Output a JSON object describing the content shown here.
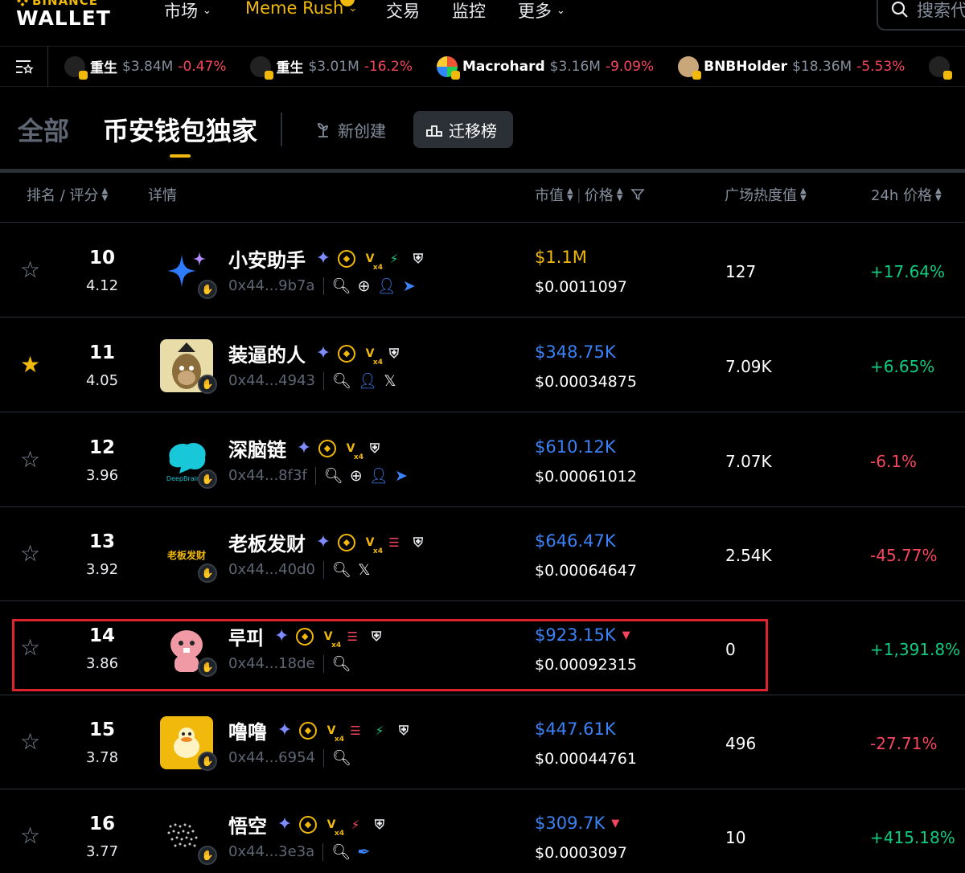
{
  "brand": {
    "top": "BINANCE",
    "name": "WALLET"
  },
  "nav": [
    {
      "label": "市场",
      "dropdown": true
    },
    {
      "label": "Meme Rush",
      "dropdown": true,
      "active": true
    },
    {
      "label": "交易",
      "dropdown": false
    },
    {
      "label": "监控",
      "dropdown": false
    },
    {
      "label": "更多",
      "dropdown": true
    }
  ],
  "search": {
    "placeholder": "搜索代"
  },
  "ticker": [
    {
      "icon": "REBORN",
      "name": "重生",
      "mcap": "$3.84M",
      "change": "-0.47%"
    },
    {
      "icon": "REBORN",
      "name": "重生",
      "mcap": "$3.01M",
      "change": "-16.2%"
    },
    {
      "name": "Macrohard",
      "mcap": "$3.16M",
      "change": "-9.09%"
    },
    {
      "name": "BNBHolder",
      "mcap": "$18.36M",
      "change": "-5.53%"
    }
  ],
  "tabs": {
    "all": "全部",
    "exclusive": "币安钱包独家",
    "new": "新创建",
    "migrated": "迁移榜"
  },
  "columns": {
    "rank": "排名 / 评分",
    "detail": "详情",
    "mcap": "市值",
    "price": "价格",
    "heat": "广场热度值",
    "change": "24h 价格"
  },
  "rows": [
    {
      "rank": "10",
      "score": "4.12",
      "name": "小安助手",
      "address": "0x44...9b7a",
      "mcap": "$1.1M",
      "price": "$0.0011097",
      "heat": "127",
      "change": "+17.64%",
      "positive": true,
      "favorite": false,
      "avatar_text": "",
      "mcap_color": "#f0b90b"
    },
    {
      "rank": "11",
      "score": "4.05",
      "name": "装逼的人",
      "address": "0x44...4943",
      "mcap": "$348.75K",
      "price": "$0.00034875",
      "heat": "7.09K",
      "change": "+6.65%",
      "positive": true,
      "favorite": true,
      "avatar_text": ""
    },
    {
      "rank": "12",
      "score": "3.96",
      "name": "深脑链",
      "address": "0x44...8f3f",
      "mcap": "$610.12K",
      "price": "$0.00061012",
      "heat": "7.07K",
      "change": "-6.1%",
      "positive": false,
      "favorite": false,
      "avatar_text": "DeepBrain C"
    },
    {
      "rank": "13",
      "score": "3.92",
      "name": "老板发财",
      "address": "0x44...40d0",
      "mcap": "$646.47K",
      "price": "$0.00064647",
      "heat": "2.54K",
      "change": "-45.77%",
      "positive": false,
      "favorite": false,
      "avatar_text": "老板发财"
    },
    {
      "rank": "14",
      "score": "3.86",
      "name": "루피",
      "address": "0x44...18de",
      "mcap": "$923.15K",
      "price": "$0.00092315",
      "heat": "0",
      "change": "+1,391.8%",
      "positive": true,
      "favorite": false,
      "avatar_text": ""
    },
    {
      "rank": "15",
      "score": "3.78",
      "name": "噜噜",
      "address": "0x44...6954",
      "mcap": "$447.61K",
      "price": "$0.00044761",
      "heat": "496",
      "change": "-27.71%",
      "positive": false,
      "favorite": false,
      "avatar_text": ""
    },
    {
      "rank": "16",
      "score": "3.77",
      "name": "悟空",
      "address": "0x44...3e3a",
      "mcap": "$309.7K",
      "price": "$0.0003097",
      "heat": "10",
      "change": "+415.18%",
      "positive": true,
      "favorite": false,
      "avatar_text": ""
    }
  ]
}
